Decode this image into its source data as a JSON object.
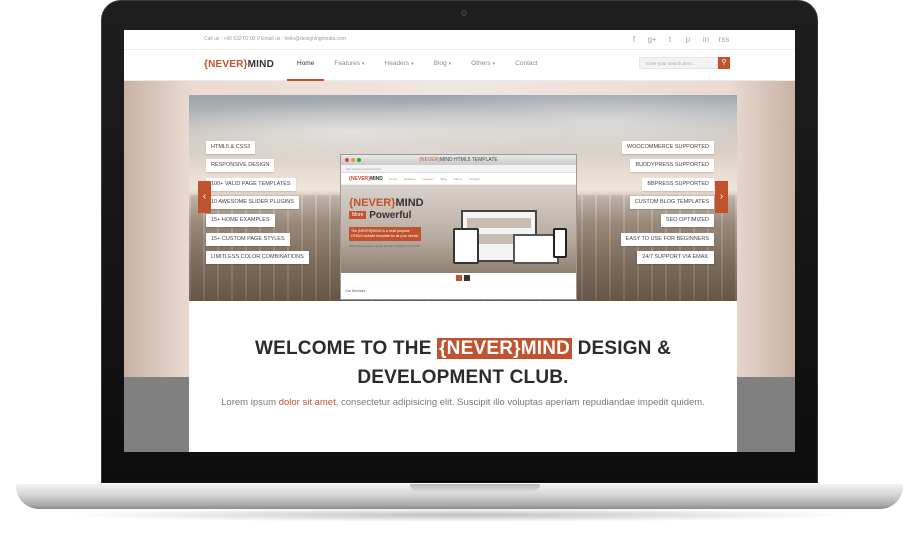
{
  "topbar": {
    "contact": "Call us : +90 532 02 02 // Email us : hello@designingmedia.com",
    "social_icons": [
      "facebook-icon",
      "google-plus-icon",
      "twitter-icon",
      "pinterest-icon",
      "linkedin-icon",
      "rss-icon"
    ],
    "social_glyphs": [
      "f",
      "g+",
      "t",
      "p",
      "in",
      "rss"
    ]
  },
  "navbar": {
    "logo": {
      "open": "{NEVER}",
      "close": "MIND"
    },
    "items": [
      {
        "label": "Home",
        "active": true,
        "dropdown": false
      },
      {
        "label": "Features",
        "dropdown": true
      },
      {
        "label": "Headers",
        "dropdown": true
      },
      {
        "label": "Blog",
        "dropdown": true
      },
      {
        "label": "Others",
        "dropdown": true
      },
      {
        "label": "Contact",
        "dropdown": false
      }
    ],
    "caret": "▾",
    "search_placeholder": "Enter your search term...",
    "search_glyph": "⚲"
  },
  "slider": {
    "prev_glyph": "‹",
    "next_glyph": "›",
    "left_tags": [
      "HTML5 & CSS3",
      "RESPONSIVE DESIGN",
      "100+ VALID PAGE TEMPLATES",
      "10 AWESOME SLIDER PLUGINS",
      "15+ HOME EXAMPLES",
      "15+ CUSTOM PAGE STYLES",
      "LIMITLESS COLOR COMBINATIONS"
    ],
    "right_tags": [
      "WOOCOMMERCE SUPPORTED",
      "BUDDYPRESS SUPPORTED",
      "BBPRESS SUPPORTED",
      "CUSTOM BLOG TEMPLATES",
      "SEO OPTIMIZED",
      "EASY TO USE FOR BEGINNERS",
      "24/7 SUPPORT VIA EMAIL"
    ],
    "mini": {
      "window_title_brand": "{NEVER}",
      "window_title_rest": "MIND HTML5 TEMPLATE",
      "url": "http://www.nevermind.com",
      "logo_open": "{NEVER}",
      "logo_close": "MIND",
      "menu": "Home Features Headers Blog Others Contact",
      "headline_open": "{NEVER}",
      "headline_close": "MIND",
      "more": "More",
      "powerful": "Powerful",
      "description": "The {NEVER}MIND is a multi purpose HTML5 website template for all your needs!",
      "subline": "100% Responsive Layout Design & Mobile Optimized",
      "services": "Our Services"
    }
  },
  "welcome": {
    "before": "WELCOME TO THE",
    "brand": "{NEVER}MIND",
    "after": "DESIGN &",
    "line2": "DEVELOPMENT CLUB."
  },
  "lead": {
    "start": "Lorem ipsum",
    "accent": "dolor sit amet",
    "rest": ", consectetur adipisicing elit. Suscipit illo voluptas aperiam repudiandae impedit quidem."
  },
  "colors": {
    "accent": "#c1522e",
    "text_dark": "#2b2b2b",
    "text_muted": "#7a7a7a"
  }
}
